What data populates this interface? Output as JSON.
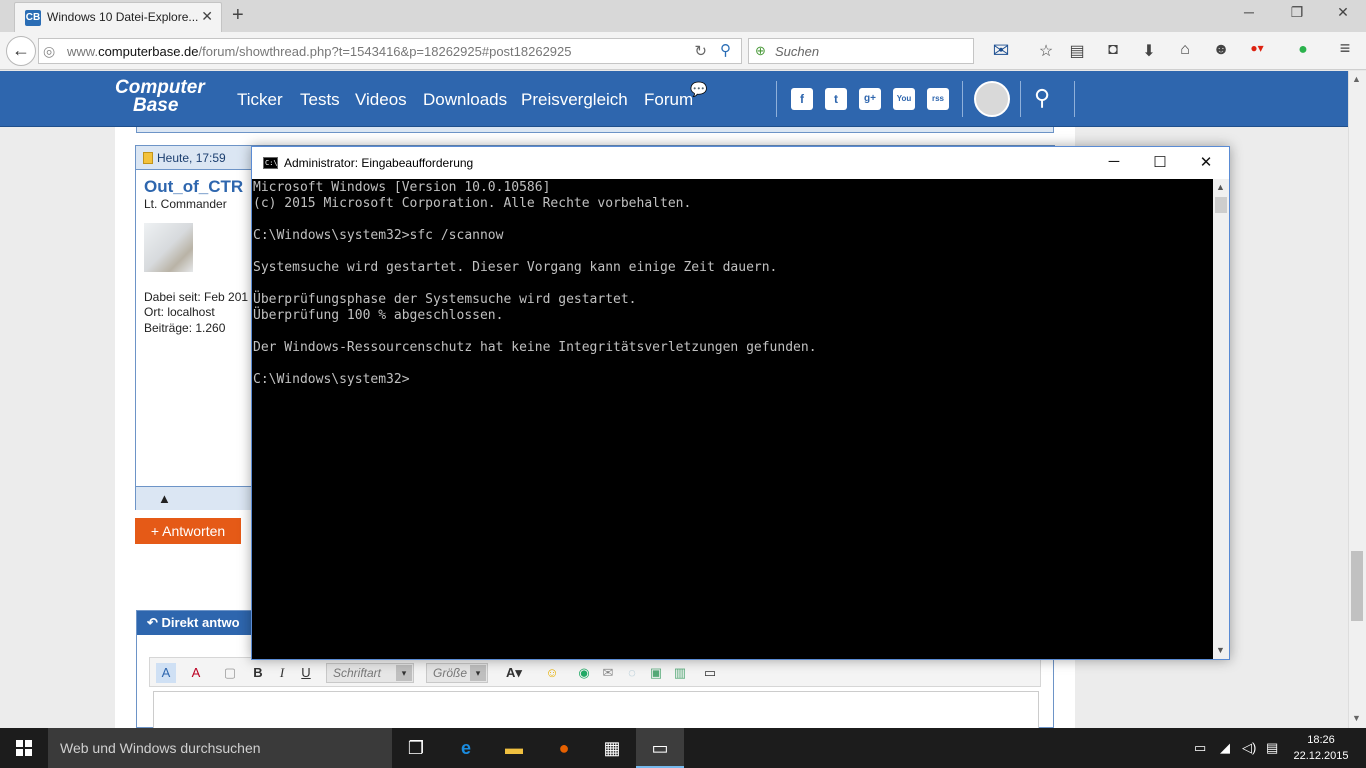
{
  "browser": {
    "tab_title": "Windows 10 Datei-Explore...",
    "tab_favicon": "CB",
    "url_prefix": "www.",
    "url_domain": "computerbase.de",
    "url_path": "/forum/showthread.php?t=1543416&p=18262925#post18262925",
    "search_placeholder": "Suchen"
  },
  "site": {
    "logo_line1": "Computer",
    "logo_line2": "Base",
    "nav": [
      "Ticker",
      "Tests",
      "Videos",
      "Downloads",
      "Preisvergleich",
      "Forum"
    ],
    "social": [
      "f",
      "t",
      "g+",
      "You",
      "rss"
    ]
  },
  "post": {
    "date": "Heute, 17:59",
    "author": "Out_of_CTR",
    "rank": "Lt. Commander",
    "joined": "Dabei seit: Feb 201",
    "location": "Ort: localhost",
    "posts": "Beiträge: 1.260"
  },
  "reply_button": "+ Antworten",
  "quick_reply": {
    "title": "Direkt antwo",
    "font_select": "Schriftart",
    "size_select": "Größe"
  },
  "cmd": {
    "title": "Administrator: Eingabeaufforderung",
    "icon_text": "C:\\",
    "lines": [
      "Microsoft Windows [Version 10.0.10586]",
      "(c) 2015 Microsoft Corporation. Alle Rechte vorbehalten.",
      "",
      "C:\\Windows\\system32>sfc /scannow",
      "",
      "Systemsuche wird gestartet. Dieser Vorgang kann einige Zeit dauern.",
      "",
      "Überprüfungsphase der Systemsuche wird gestartet.",
      "Überprüfung 100 % abgeschlossen.",
      "",
      "Der Windows-Ressourcenschutz hat keine Integritätsverletzungen gefunden.",
      "",
      "C:\\Windows\\system32>"
    ]
  },
  "taskbar": {
    "search_text": "Web und Windows durchsuchen",
    "time": "18:26",
    "date": "22.12.2015"
  },
  "colors": {
    "site_blue": "#2e66ae",
    "reply_orange": "#e55a17",
    "taskbar": "#1c1c1c"
  }
}
